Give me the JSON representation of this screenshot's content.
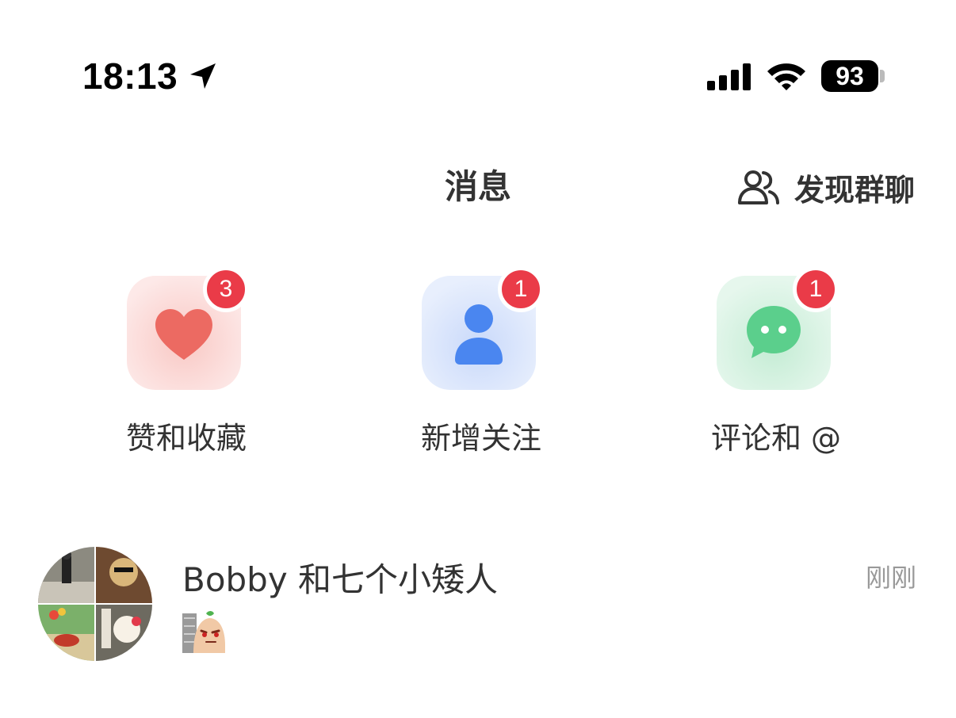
{
  "status_bar": {
    "time": "18:13",
    "battery": "93",
    "icons": [
      "location-arrow-icon",
      "cellular-signal-icon",
      "wifi-icon",
      "battery-icon"
    ]
  },
  "header": {
    "title": "消息",
    "discover_label": "发现群聊",
    "discover_icon": "group-users-icon"
  },
  "categories": [
    {
      "label": "赞和收藏",
      "badge": "3",
      "icon": "heart-icon",
      "color": "#ec6a62",
      "tile_bg": "#fde9e8"
    },
    {
      "label": "新增关注",
      "badge": "1",
      "icon": "person-icon",
      "color": "#4a86f0",
      "tile_bg": "#e6eefc"
    },
    {
      "label": "评论和 @",
      "badge": "1",
      "icon": "chat-bubble-icon",
      "color": "#5bcf8c",
      "tile_bg": "#e3f6ea"
    }
  ],
  "conversations": [
    {
      "name": "Bobby 和七个小矮人",
      "time": "刚刚",
      "preview": "sticker"
    }
  ],
  "colors": {
    "badge": "#ea3b48",
    "text": "#333333",
    "muted": "#999999"
  }
}
